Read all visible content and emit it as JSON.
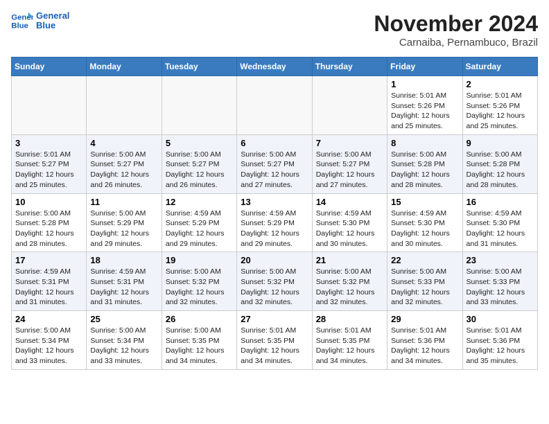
{
  "logo": {
    "line1": "General",
    "line2": "Blue"
  },
  "title": "November 2024",
  "subtitle": "Carnaiba, Pernambuco, Brazil",
  "weekdays": [
    "Sunday",
    "Monday",
    "Tuesday",
    "Wednesday",
    "Thursday",
    "Friday",
    "Saturday"
  ],
  "weeks": [
    [
      {
        "day": "",
        "info": ""
      },
      {
        "day": "",
        "info": ""
      },
      {
        "day": "",
        "info": ""
      },
      {
        "day": "",
        "info": ""
      },
      {
        "day": "",
        "info": ""
      },
      {
        "day": "1",
        "info": "Sunrise: 5:01 AM\nSunset: 5:26 PM\nDaylight: 12 hours and 25 minutes."
      },
      {
        "day": "2",
        "info": "Sunrise: 5:01 AM\nSunset: 5:26 PM\nDaylight: 12 hours and 25 minutes."
      }
    ],
    [
      {
        "day": "3",
        "info": "Sunrise: 5:01 AM\nSunset: 5:27 PM\nDaylight: 12 hours and 25 minutes."
      },
      {
        "day": "4",
        "info": "Sunrise: 5:00 AM\nSunset: 5:27 PM\nDaylight: 12 hours and 26 minutes."
      },
      {
        "day": "5",
        "info": "Sunrise: 5:00 AM\nSunset: 5:27 PM\nDaylight: 12 hours and 26 minutes."
      },
      {
        "day": "6",
        "info": "Sunrise: 5:00 AM\nSunset: 5:27 PM\nDaylight: 12 hours and 27 minutes."
      },
      {
        "day": "7",
        "info": "Sunrise: 5:00 AM\nSunset: 5:27 PM\nDaylight: 12 hours and 27 minutes."
      },
      {
        "day": "8",
        "info": "Sunrise: 5:00 AM\nSunset: 5:28 PM\nDaylight: 12 hours and 28 minutes."
      },
      {
        "day": "9",
        "info": "Sunrise: 5:00 AM\nSunset: 5:28 PM\nDaylight: 12 hours and 28 minutes."
      }
    ],
    [
      {
        "day": "10",
        "info": "Sunrise: 5:00 AM\nSunset: 5:28 PM\nDaylight: 12 hours and 28 minutes."
      },
      {
        "day": "11",
        "info": "Sunrise: 5:00 AM\nSunset: 5:29 PM\nDaylight: 12 hours and 29 minutes."
      },
      {
        "day": "12",
        "info": "Sunrise: 4:59 AM\nSunset: 5:29 PM\nDaylight: 12 hours and 29 minutes."
      },
      {
        "day": "13",
        "info": "Sunrise: 4:59 AM\nSunset: 5:29 PM\nDaylight: 12 hours and 29 minutes."
      },
      {
        "day": "14",
        "info": "Sunrise: 4:59 AM\nSunset: 5:30 PM\nDaylight: 12 hours and 30 minutes."
      },
      {
        "day": "15",
        "info": "Sunrise: 4:59 AM\nSunset: 5:30 PM\nDaylight: 12 hours and 30 minutes."
      },
      {
        "day": "16",
        "info": "Sunrise: 4:59 AM\nSunset: 5:30 PM\nDaylight: 12 hours and 31 minutes."
      }
    ],
    [
      {
        "day": "17",
        "info": "Sunrise: 4:59 AM\nSunset: 5:31 PM\nDaylight: 12 hours and 31 minutes."
      },
      {
        "day": "18",
        "info": "Sunrise: 4:59 AM\nSunset: 5:31 PM\nDaylight: 12 hours and 31 minutes."
      },
      {
        "day": "19",
        "info": "Sunrise: 5:00 AM\nSunset: 5:32 PM\nDaylight: 12 hours and 32 minutes."
      },
      {
        "day": "20",
        "info": "Sunrise: 5:00 AM\nSunset: 5:32 PM\nDaylight: 12 hours and 32 minutes."
      },
      {
        "day": "21",
        "info": "Sunrise: 5:00 AM\nSunset: 5:32 PM\nDaylight: 12 hours and 32 minutes."
      },
      {
        "day": "22",
        "info": "Sunrise: 5:00 AM\nSunset: 5:33 PM\nDaylight: 12 hours and 32 minutes."
      },
      {
        "day": "23",
        "info": "Sunrise: 5:00 AM\nSunset: 5:33 PM\nDaylight: 12 hours and 33 minutes."
      }
    ],
    [
      {
        "day": "24",
        "info": "Sunrise: 5:00 AM\nSunset: 5:34 PM\nDaylight: 12 hours and 33 minutes."
      },
      {
        "day": "25",
        "info": "Sunrise: 5:00 AM\nSunset: 5:34 PM\nDaylight: 12 hours and 33 minutes."
      },
      {
        "day": "26",
        "info": "Sunrise: 5:00 AM\nSunset: 5:35 PM\nDaylight: 12 hours and 34 minutes."
      },
      {
        "day": "27",
        "info": "Sunrise: 5:01 AM\nSunset: 5:35 PM\nDaylight: 12 hours and 34 minutes."
      },
      {
        "day": "28",
        "info": "Sunrise: 5:01 AM\nSunset: 5:35 PM\nDaylight: 12 hours and 34 minutes."
      },
      {
        "day": "29",
        "info": "Sunrise: 5:01 AM\nSunset: 5:36 PM\nDaylight: 12 hours and 34 minutes."
      },
      {
        "day": "30",
        "info": "Sunrise: 5:01 AM\nSunset: 5:36 PM\nDaylight: 12 hours and 35 minutes."
      }
    ]
  ]
}
